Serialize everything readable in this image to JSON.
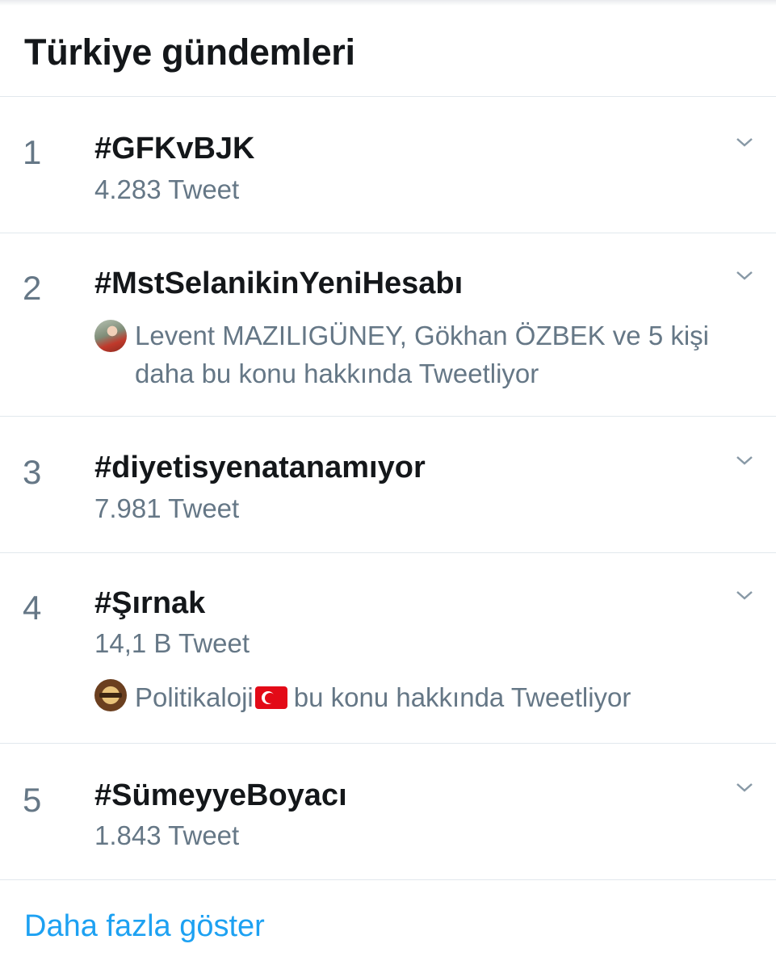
{
  "header": {
    "title": "Türkiye gündemleri"
  },
  "trends": [
    {
      "rank": "1",
      "name": "#GFKvBJK",
      "meta": "4.283 Tweet"
    },
    {
      "rank": "2",
      "name": "#MstSelanikinYeniHesabı",
      "context": "Levent MAZILIGÜNEY, Gökhan ÖZBEK ve 5 kişi daha bu konu hakkında Tweetliyor"
    },
    {
      "rank": "3",
      "name": "#diyetisyenatanamıyor",
      "meta": "7.981 Tweet"
    },
    {
      "rank": "4",
      "name": "#Şırnak",
      "meta": "14,1 B Tweet",
      "context_name": "Politikaloji",
      "context_rest": "bu konu hakkında Tweetliyor"
    },
    {
      "rank": "5",
      "name": "#SümeyyeBoyacı",
      "meta": "1.843 Tweet"
    }
  ],
  "footer": {
    "show_more": "Daha fazla göster"
  },
  "icons": {
    "chevron": "chevron-down-icon",
    "avatar_1": "user-avatar-icon",
    "avatar_2": "politikaloji-avatar-icon",
    "flag": "turkey-flag-icon"
  },
  "colors": {
    "text_primary": "#14171a",
    "text_secondary": "#657786",
    "link": "#1da1f2",
    "divider": "#e1e8ed"
  }
}
